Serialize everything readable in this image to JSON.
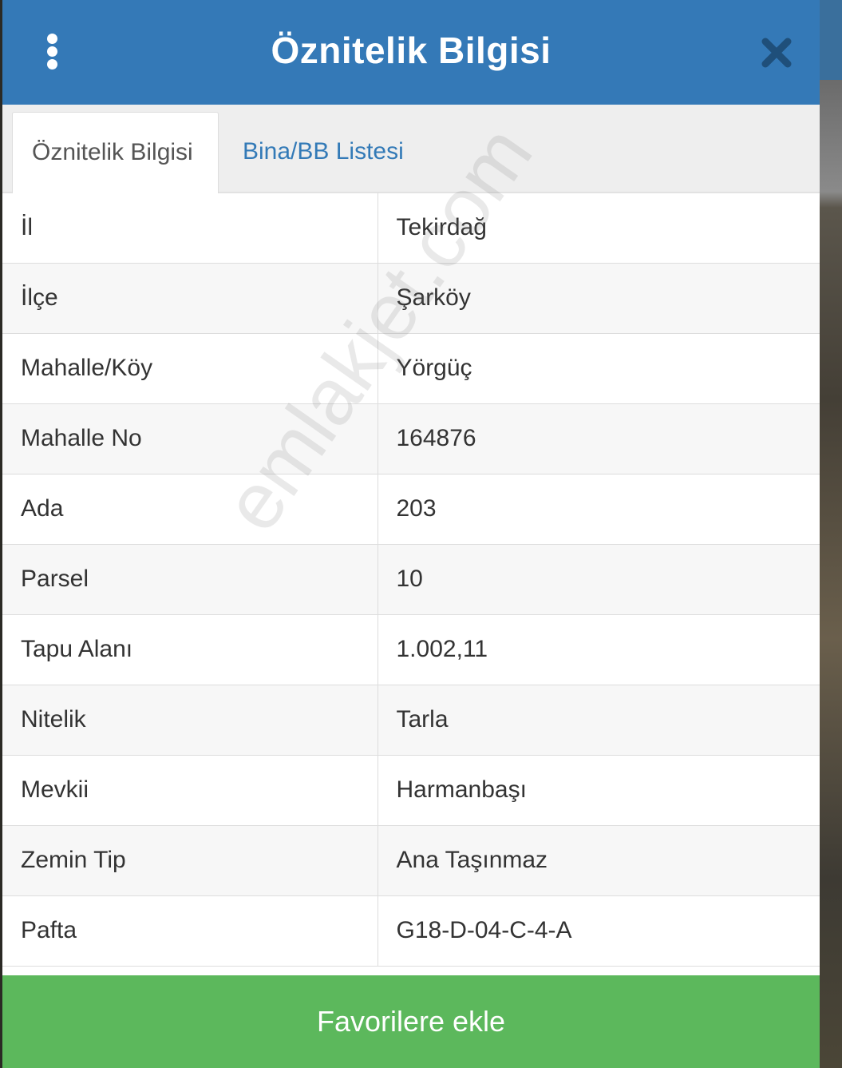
{
  "header": {
    "title": "Öznitelik Bilgisi",
    "menu_icon": "vertical-dots-icon",
    "close_icon": "close-icon"
  },
  "tabs": [
    {
      "label": "Öznitelik Bilgisi",
      "active": true
    },
    {
      "label": "Bina/BB Listesi",
      "active": false
    }
  ],
  "attributes": [
    {
      "key": "İl",
      "value": "Tekirdağ"
    },
    {
      "key": "İlçe",
      "value": "Şarköy"
    },
    {
      "key": "Mahalle/Köy",
      "value": "Yörgüç"
    },
    {
      "key": "Mahalle No",
      "value": "164876"
    },
    {
      "key": "Ada",
      "value": "203"
    },
    {
      "key": "Parsel",
      "value": "10"
    },
    {
      "key": "Tapu Alanı",
      "value": "1.002,11"
    },
    {
      "key": "Nitelik",
      "value": "Tarla"
    },
    {
      "key": "Mevkii",
      "value": "Harmanbaşı"
    },
    {
      "key": "Zemin Tip",
      "value": "Ana Taşınmaz"
    },
    {
      "key": "Pafta",
      "value": "G18-D-04-C-4-A"
    }
  ],
  "watermark": "emlakjet.com",
  "footer": {
    "favorite_label": "Favorilere ekle"
  },
  "colors": {
    "header_bg": "#3479b7",
    "tab_link": "#337ab7",
    "favorite_button": "#5cb85c"
  }
}
